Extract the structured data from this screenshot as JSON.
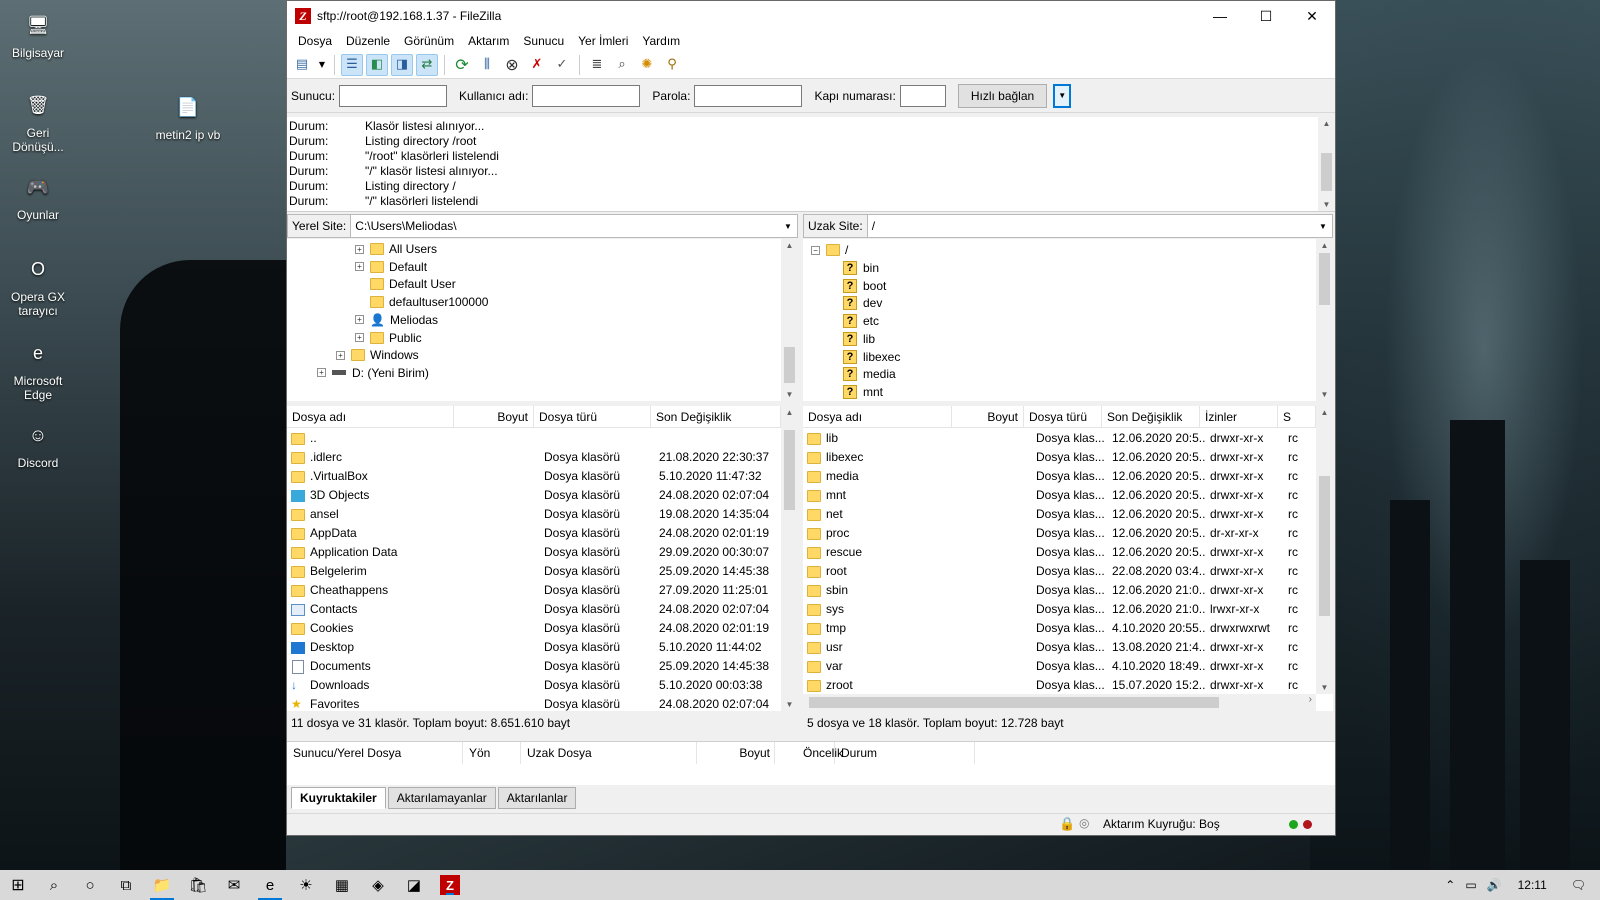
{
  "desktop": {
    "icons": [
      {
        "label": "Bilgisayar",
        "icon": "computer-icon",
        "glyph": "🖥"
      },
      {
        "label": "Geri Dönüşü...",
        "icon": "recycle-bin-icon",
        "glyph": "🗑"
      },
      {
        "label": "Oyunlar",
        "icon": "games-folder-icon",
        "glyph": "🎮"
      },
      {
        "label": "Opera GX tarayıcı",
        "icon": "opera-gx-icon",
        "glyph": "O"
      },
      {
        "label": "Microsoft Edge",
        "icon": "edge-icon",
        "glyph": "e"
      },
      {
        "label": "Discord",
        "icon": "discord-icon",
        "glyph": "☺"
      },
      {
        "label": "metin2 ip vb",
        "icon": "text-file-icon",
        "glyph": "📄"
      }
    ]
  },
  "window": {
    "title": "sftp://root@192.168.1.37 - FileZilla",
    "logo": "Z",
    "controls": {
      "minimize": "—",
      "maximize": "☐",
      "close": "✕"
    }
  },
  "menu": [
    "Dosya",
    "Düzenle",
    "Görünüm",
    "Aktarım",
    "Sunucu",
    "Yer İmleri",
    "Yardım"
  ],
  "quickconnect": {
    "host_label": "Sunucu:",
    "user_label": "Kullanıcı adı:",
    "pass_label": "Parola:",
    "port_label": "Kapı numarası:",
    "host_value": "",
    "user_value": "",
    "pass_value": "",
    "port_value": "",
    "button": "Hızlı bağlan"
  },
  "log": [
    {
      "k": "Durum:",
      "v": "Klasör listesi alınıyor..."
    },
    {
      "k": "Durum:",
      "v": "Listing directory /root"
    },
    {
      "k": "Durum:",
      "v": "\"/root\" klasörleri listelendi"
    },
    {
      "k": "Durum:",
      "v": "\"/\" klasör listesi alınıyor..."
    },
    {
      "k": "Durum:",
      "v": "Listing directory /"
    },
    {
      "k": "Durum:",
      "v": "\"/\" klasörleri listelendi"
    }
  ],
  "local": {
    "label": "Yerel Site:",
    "path": "C:\\Users\\Meliodas\\",
    "tree": [
      {
        "name": "All Users",
        "level": 3,
        "plus": true,
        "type": "folder"
      },
      {
        "name": "Default",
        "level": 3,
        "plus": true,
        "type": "folder"
      },
      {
        "name": "Default User",
        "level": 3,
        "plus": false,
        "type": "folder"
      },
      {
        "name": "defaultuser100000",
        "level": 3,
        "plus": false,
        "type": "folder"
      },
      {
        "name": "Meliodas",
        "level": 3,
        "plus": true,
        "type": "user"
      },
      {
        "name": "Public",
        "level": 3,
        "plus": true,
        "type": "folder"
      },
      {
        "name": "Windows",
        "level": 2,
        "plus": true,
        "type": "folder"
      },
      {
        "name": "D: (Yeni Birim)",
        "level": 1,
        "plus": true,
        "type": "drive"
      }
    ],
    "columns": [
      "Dosya adı",
      "Boyut",
      "Dosya türü",
      "Son Değişiklik"
    ],
    "files": [
      {
        "name": "..",
        "size": "",
        "type": "",
        "modified": ""
      },
      {
        "name": ".idlerc",
        "size": "",
        "type": "Dosya klasörü",
        "modified": "21.08.2020 22:30:37"
      },
      {
        "name": ".VirtualBox",
        "size": "",
        "type": "Dosya klasörü",
        "modified": "5.10.2020 11:47:32"
      },
      {
        "name": "3D Objects",
        "size": "",
        "type": "Dosya klasörü",
        "modified": "24.08.2020 02:07:04"
      },
      {
        "name": "ansel",
        "size": "",
        "type": "Dosya klasörü",
        "modified": "19.08.2020 14:35:04"
      },
      {
        "name": "AppData",
        "size": "",
        "type": "Dosya klasörü",
        "modified": "24.08.2020 02:01:19"
      },
      {
        "name": "Application Data",
        "size": "",
        "type": "Dosya klasörü",
        "modified": "29.09.2020 00:30:07"
      },
      {
        "name": "Belgelerim",
        "size": "",
        "type": "Dosya klasörü",
        "modified": "25.09.2020 14:45:38"
      },
      {
        "name": "Cheathappens",
        "size": "",
        "type": "Dosya klasörü",
        "modified": "27.09.2020 11:25:01"
      },
      {
        "name": "Contacts",
        "size": "",
        "type": "Dosya klasörü",
        "modified": "24.08.2020 02:07:04"
      },
      {
        "name": "Cookies",
        "size": "",
        "type": "Dosya klasörü",
        "modified": "24.08.2020 02:01:19"
      },
      {
        "name": "Desktop",
        "size": "",
        "type": "Dosya klasörü",
        "modified": "5.10.2020 11:44:02"
      },
      {
        "name": "Documents",
        "size": "",
        "type": "Dosya klasörü",
        "modified": "25.09.2020 14:45:38"
      },
      {
        "name": "Downloads",
        "size": "",
        "type": "Dosya klasörü",
        "modified": "5.10.2020 00:03:38"
      },
      {
        "name": "Favorites",
        "size": "",
        "type": "Dosya klasörü",
        "modified": "24.08.2020 02:07:04"
      }
    ],
    "status": "11 dosya ve 31 klasör. Toplam boyut: 8.651.610 bayt"
  },
  "remote": {
    "label": "Uzak Site:",
    "path": "/",
    "tree_root": "/",
    "tree": [
      "bin",
      "boot",
      "dev",
      "etc",
      "lib",
      "libexec",
      "media",
      "mnt"
    ],
    "columns": [
      "Dosya adı",
      "Boyut",
      "Dosya türü",
      "Son Değişiklik",
      "İzinler",
      "S"
    ],
    "files": [
      {
        "name": "lib",
        "size": "",
        "type": "Dosya klas...",
        "modified": "12.06.2020 20:5...",
        "perms": "drwxr-xr-x",
        "owner": "rc"
      },
      {
        "name": "libexec",
        "size": "",
        "type": "Dosya klas...",
        "modified": "12.06.2020 20:5...",
        "perms": "drwxr-xr-x",
        "owner": "rc"
      },
      {
        "name": "media",
        "size": "",
        "type": "Dosya klas...",
        "modified": "12.06.2020 20:5...",
        "perms": "drwxr-xr-x",
        "owner": "rc"
      },
      {
        "name": "mnt",
        "size": "",
        "type": "Dosya klas...",
        "modified": "12.06.2020 20:5...",
        "perms": "drwxr-xr-x",
        "owner": "rc"
      },
      {
        "name": "net",
        "size": "",
        "type": "Dosya klas...",
        "modified": "12.06.2020 20:5...",
        "perms": "drwxr-xr-x",
        "owner": "rc"
      },
      {
        "name": "proc",
        "size": "",
        "type": "Dosya klas...",
        "modified": "12.06.2020 20:5...",
        "perms": "dr-xr-xr-x",
        "owner": "rc"
      },
      {
        "name": "rescue",
        "size": "",
        "type": "Dosya klas...",
        "modified": "12.06.2020 20:5...",
        "perms": "drwxr-xr-x",
        "owner": "rc"
      },
      {
        "name": "root",
        "size": "",
        "type": "Dosya klas...",
        "modified": "22.08.2020 03:4...",
        "perms": "drwxr-xr-x",
        "owner": "rc"
      },
      {
        "name": "sbin",
        "size": "",
        "type": "Dosya klas...",
        "modified": "12.06.2020 21:0...",
        "perms": "drwxr-xr-x",
        "owner": "rc"
      },
      {
        "name": "sys",
        "size": "",
        "type": "Dosya klas...",
        "modified": "12.06.2020 21:0...",
        "perms": "lrwxr-xr-x",
        "owner": "rc"
      },
      {
        "name": "tmp",
        "size": "",
        "type": "Dosya klas...",
        "modified": "4.10.2020 20:55...",
        "perms": "drwxrwxrwt",
        "owner": "rc"
      },
      {
        "name": "usr",
        "size": "",
        "type": "Dosya klas...",
        "modified": "13.08.2020 21:4...",
        "perms": "drwxr-xr-x",
        "owner": "rc"
      },
      {
        "name": "var",
        "size": "",
        "type": "Dosya klas...",
        "modified": "4.10.2020 18:49...",
        "perms": "drwxr-xr-x",
        "owner": "rc"
      },
      {
        "name": "zroot",
        "size": "",
        "type": "Dosya klas...",
        "modified": "15.07.2020 15:2...",
        "perms": "drwxr-xr-x",
        "owner": "rc"
      }
    ],
    "status": "5 dosya ve 18 klasör. Toplam boyut: 12.728 bayt"
  },
  "queue": {
    "columns": [
      "Sunucu/Yerel Dosya",
      "Yön",
      "Uzak Dosya",
      "Boyut",
      "Öncelik",
      "Durum"
    ],
    "tabs": [
      "Kuyruktakiler",
      "Aktarılamayanlar",
      "Aktarılanlar"
    ],
    "status": "Aktarım Kuyruğu: Boş"
  },
  "taskbar": {
    "clock": "12:11",
    "apps": [
      {
        "name": "file-explorer-icon",
        "glyph": "📁"
      },
      {
        "name": "store-icon",
        "glyph": "🛍"
      },
      {
        "name": "mail-icon",
        "glyph": "✉"
      },
      {
        "name": "edge-icon",
        "glyph": "e"
      },
      {
        "name": "game-icon",
        "glyph": "☀"
      },
      {
        "name": "winrar-icon",
        "glyph": "▦"
      },
      {
        "name": "virtualbox-icon",
        "glyph": "◈"
      },
      {
        "name": "app-icon",
        "glyph": "◪"
      },
      {
        "name": "filezilla-icon",
        "glyph": "Z"
      }
    ]
  },
  "colors": {
    "accent": "#0078d7",
    "folder": "#ffd866",
    "logo": "#bf0000"
  }
}
